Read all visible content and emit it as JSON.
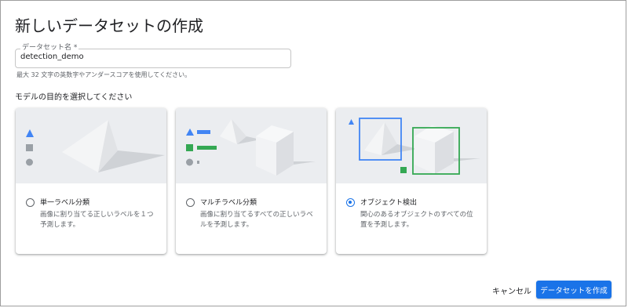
{
  "dialog": {
    "title": "新しいデータセットの作成"
  },
  "name_field": {
    "label": "データセット名 *",
    "value": "detection_demo",
    "hint": "最大 32 文字の英数字やアンダースコアを使用してください。"
  },
  "objective": {
    "label": "モデルの目的を選択してください",
    "options": [
      {
        "title": "単一ラベル分類",
        "description": "画像に割り当てる正しいラベルを１つ予測します。",
        "selected": false
      },
      {
        "title": "マルチラベル分類",
        "description": "画像に割り当てるすべての正しいラベルを予測します。",
        "selected": false
      },
      {
        "title": "オブジェクト検出",
        "description": "関心のあるオブジェクトのすべての位置を予測します。",
        "selected": true
      }
    ]
  },
  "actions": {
    "cancel_label": "キャンセル",
    "create_label": "データセットを作成"
  },
  "colors": {
    "accent": "#1a73e8",
    "illustration_bg": "#ebedf0",
    "shape_blue": "#4285f4",
    "shape_green": "#34a853",
    "shape_gray": "#9aa0a6"
  }
}
